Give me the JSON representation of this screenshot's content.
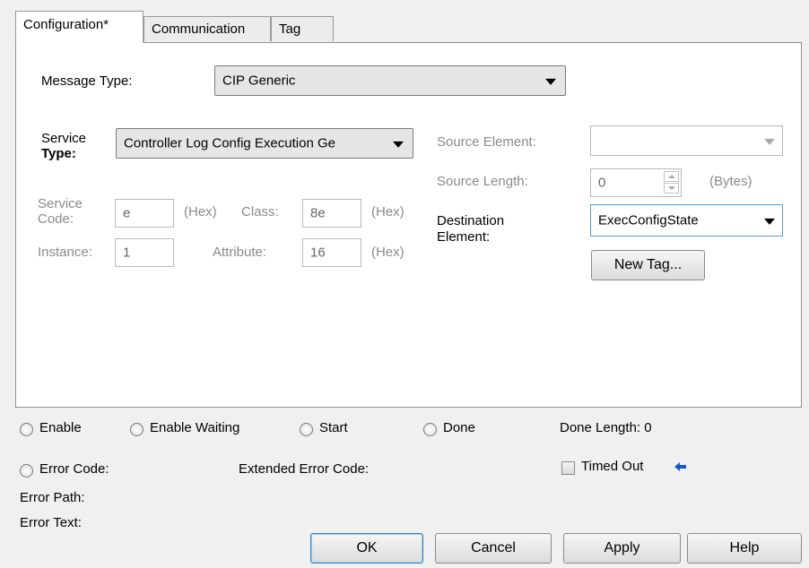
{
  "tabs": [
    {
      "label": "Configuration*",
      "active": true
    },
    {
      "label": "Communication",
      "active": false
    },
    {
      "label": "Tag",
      "active": false
    }
  ],
  "config": {
    "message_type_label": "Message Type:",
    "message_type_value": "CIP Generic",
    "service_type_label_line1": "Service",
    "service_type_label_line2": "Type:",
    "service_type_value": "Controller Log Config Execution Ge",
    "service_code_label_line1": "Service",
    "service_code_label_line2": "Code:",
    "service_code_value": "e",
    "hex_label": "(Hex)",
    "class_label": "Class:",
    "class_value": "8e",
    "instance_label": "Instance:",
    "instance_value": "1",
    "attribute_label": "Attribute:",
    "attribute_value": "16",
    "source_element_label": "Source Element:",
    "source_element_value": "",
    "source_length_label": "Source Length:",
    "source_length_value": "0",
    "bytes_label": "(Bytes)",
    "destination_label_line1": "Destination",
    "destination_label_line2": "Element:",
    "destination_value": "ExecConfigState",
    "new_tag_label": "New Tag..."
  },
  "status": {
    "enable": "Enable",
    "enable_waiting": "Enable Waiting",
    "start": "Start",
    "done": "Done",
    "done_length": "Done Length: 0",
    "error_code": "Error Code:",
    "extended_error_code": "Extended Error Code:",
    "timed_out": "Timed Out",
    "error_path": "Error Path:",
    "error_text": "Error Text:"
  },
  "buttons": {
    "ok": "OK",
    "cancel": "Cancel",
    "apply": "Apply",
    "help": "Help"
  },
  "colors": {
    "accent_arrow": "#1a55d6",
    "disabled_text": "#8a8a8a"
  }
}
